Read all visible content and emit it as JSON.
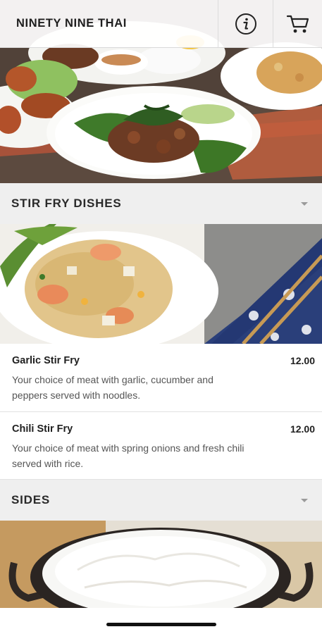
{
  "header": {
    "title": "NINETY NINE THAI",
    "info_icon": "info-icon",
    "cart_icon": "cart-icon"
  },
  "sections": [
    {
      "title": "STIR FRY DISHES",
      "chevron_icon": "chevron-down-icon",
      "items": [
        {
          "name": "Garlic Stir Fry",
          "price": "12.00",
          "description": "Your choice of meat with garlic, cucumber and peppers served with noodles."
        },
        {
          "name": "Chili Stir Fry",
          "price": "12.00",
          "description": "Your choice of meat with spring onions and fresh chili served with rice."
        }
      ]
    },
    {
      "title": "SIDES",
      "chevron_icon": "chevron-down-icon",
      "items": []
    }
  ],
  "colors": {
    "section_background": "#efefef",
    "divider": "#e2e2e2",
    "text_primary": "#1f1f1f",
    "text_secondary": "#555555"
  }
}
